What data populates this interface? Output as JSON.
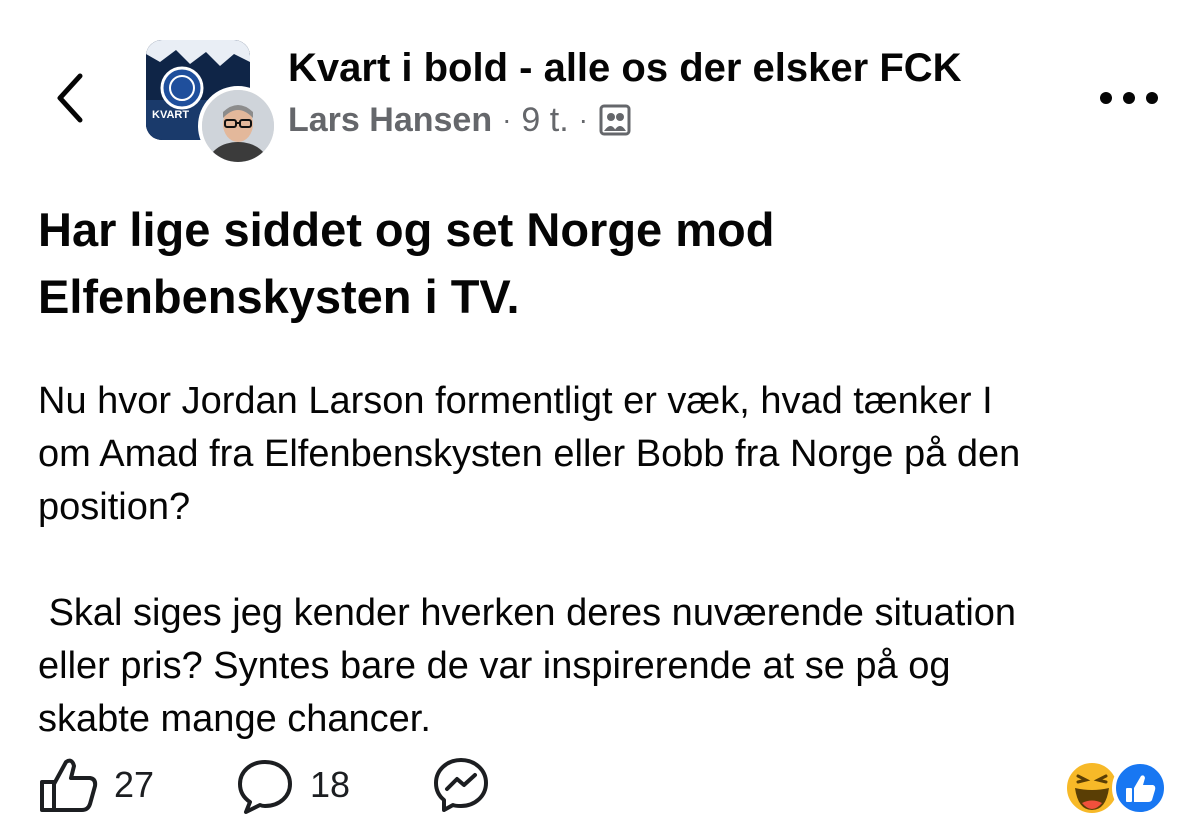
{
  "header": {
    "back_icon": "chevron-left-icon",
    "group_name": "Kvart i bold - alle os der elsker FCK",
    "group_avatar_text": "KVART",
    "author": "Lars Hansen",
    "separator": "·",
    "timestamp": "9 t.",
    "audience_icon": "group-audience-icon",
    "more_icon": "more-horizontal-icon"
  },
  "post": {
    "title": "Har lige siddet og set Norge mod\nElfenbenskysten i TV.",
    "body": "Nu hvor Jordan Larson formentligt er væk, hvad tænker I\nom Amad fra Elfenbenskysten eller Bobb fra Norge på den\nposition?\n\n Skal siges jeg kender hverken deres nuværende situation\neller pris? Syntes bare de var inspirerende at se på og\nskabte mange chancer."
  },
  "actions": {
    "like_count": "27",
    "comment_count": "18",
    "like_icon": "thumbs-up-icon",
    "comment_icon": "comment-bubble-icon",
    "share_icon": "messenger-icon"
  },
  "reactions": {
    "icons": [
      "haha-reaction-icon",
      "like-reaction-icon"
    ],
    "like_color": "#1877f2",
    "haha_color": "#f7b928"
  }
}
